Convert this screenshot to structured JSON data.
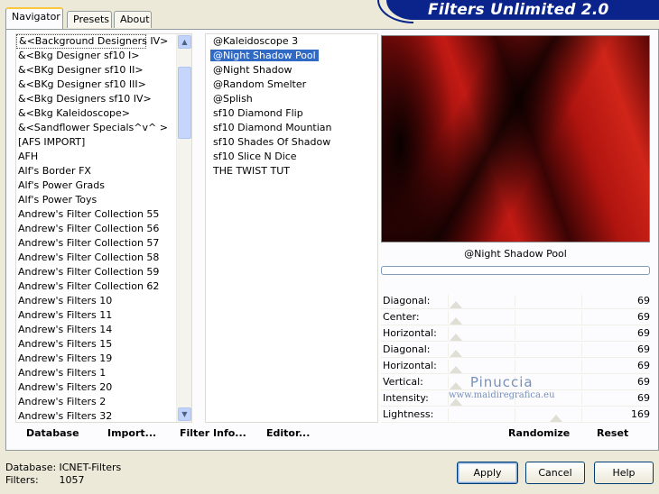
{
  "app": {
    "title": "Filters Unlimited 2.0"
  },
  "tabs": [
    {
      "label": "Navigator",
      "active": true
    },
    {
      "label": "Presets",
      "active": false
    },
    {
      "label": "About",
      "active": false
    }
  ],
  "categories": [
    "&<Background Designers IV>",
    "&<Bkg Designer sf10 I>",
    "&<BKg Designer sf10 II>",
    "&<BKg Designer sf10 III>",
    "&<Bkg Designers sf10 IV>",
    "&<Bkg Kaleidoscope>",
    "&<Sandflower Specials^v^ >",
    "[AFS IMPORT]",
    "AFH",
    "Alf's Border FX",
    "Alf's Power Grads",
    "Alf's Power Toys",
    "Andrew's Filter Collection 55",
    "Andrew's Filter Collection 56",
    "Andrew's Filter Collection 57",
    "Andrew's Filter Collection 58",
    "Andrew's Filter Collection 59",
    "Andrew's Filter Collection 62",
    "Andrew's Filters 10",
    "Andrew's Filters 11",
    "Andrew's Filters 14",
    "Andrew's Filters 15",
    "Andrew's Filters 19",
    "Andrew's Filters 1",
    "Andrew's Filters 20",
    "Andrew's Filters 2",
    "Andrew's Filters 32"
  ],
  "selected_category_index": 0,
  "filters": [
    "@Kaleidoscope 3",
    "@Night Shadow Pool",
    "@Night Shadow",
    "@Random Smelter",
    "@Splish",
    "sf10 Diamond Flip",
    "sf10 Diamond Mountian",
    "sf10 Shades Of Shadow",
    "sf10 Slice N Dice",
    "THE TWIST TUT"
  ],
  "selected_filter_index": 1,
  "preview": {
    "filter_name": "@Night Shadow Pool"
  },
  "sliders": [
    {
      "label": "Diagonal:",
      "value": "69",
      "level": 69
    },
    {
      "label": "Center:",
      "value": "69",
      "level": 69
    },
    {
      "label": "Horizontal:",
      "value": "69",
      "level": 69
    },
    {
      "label": "Diagonal:",
      "value": "69",
      "level": 69
    },
    {
      "label": "Horizontal:",
      "value": "69",
      "level": 69
    },
    {
      "label": "Vertical:",
      "value": "69",
      "level": 69
    },
    {
      "label": "Intensity:",
      "value": "69",
      "level": 69
    },
    {
      "label": "Lightness:",
      "value": "169",
      "level": 169
    }
  ],
  "watermark": {
    "line1": "Pinuccia",
    "line2": "www.maidiregrafica.eu"
  },
  "actions": {
    "database": "Database",
    "import": "Import...",
    "filter_info": "Filter Info...",
    "editor": "Editor...",
    "randomize": "Randomize",
    "reset": "Reset"
  },
  "footer": {
    "database_label": "Database:",
    "database_value": "ICNET-Filters",
    "filters_label": "Filters:",
    "filters_value": "1057"
  },
  "buttons": {
    "apply": "Apply",
    "cancel": "Cancel",
    "help": "Help"
  }
}
